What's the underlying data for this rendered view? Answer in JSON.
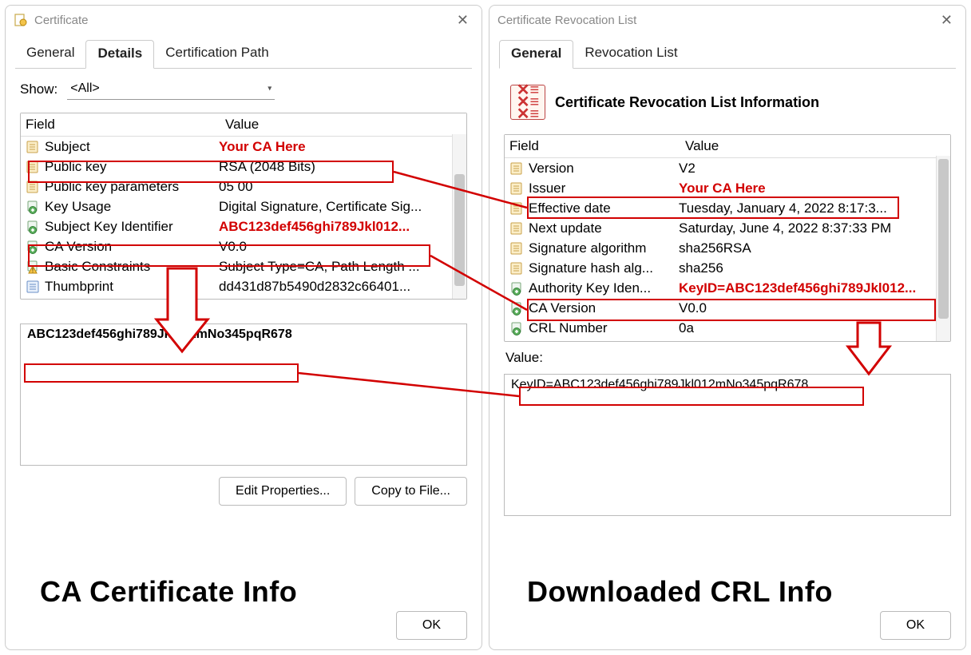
{
  "left": {
    "title": "Certificate",
    "tabs": [
      "General",
      "Details",
      "Certification Path"
    ],
    "activeTab": "Details",
    "showLabel": "Show:",
    "showValue": "<All>",
    "headers": {
      "field": "Field",
      "value": "Value"
    },
    "rows": [
      {
        "icon": "doc",
        "field": "Subject",
        "value": "Your CA Here",
        "highlight": true
      },
      {
        "icon": "doc",
        "field": "Public key",
        "value": "RSA (2048 Bits)"
      },
      {
        "icon": "doc",
        "field": "Public key parameters",
        "value": "05 00"
      },
      {
        "icon": "ext",
        "field": "Key Usage",
        "value": "Digital Signature, Certificate Sig..."
      },
      {
        "icon": "ext",
        "field": "Subject Key Identifier",
        "value": "ABC123def456ghi789Jkl012...",
        "highlight": true
      },
      {
        "icon": "ext",
        "field": "CA Version",
        "value": "V0.0"
      },
      {
        "icon": "warn",
        "field": "Basic Constraints",
        "value": "Subject Type=CA, Path Length ..."
      },
      {
        "icon": "prop",
        "field": "Thumbprint",
        "value": "dd431d87b5490d2832c66401..."
      }
    ],
    "detailValue": "ABC123def456ghi789Jkl012mNo345pqR678",
    "buttons": {
      "edit": "Edit Properties...",
      "copy": "Copy to File...",
      "ok": "OK"
    },
    "caption": "CA Certificate Info"
  },
  "right": {
    "title": "Certificate Revocation List",
    "tabs": [
      "General",
      "Revocation List"
    ],
    "activeTab": "General",
    "headerTitle": "Certificate Revocation List Information",
    "headers": {
      "field": "Field",
      "value": "Value"
    },
    "rows": [
      {
        "icon": "doc",
        "field": "Version",
        "value": "V2"
      },
      {
        "icon": "doc",
        "field": "Issuer",
        "value": "Your CA Here",
        "highlight": true
      },
      {
        "icon": "doc",
        "field": "Effective date",
        "value": "Tuesday, January 4, 2022 8:17:3..."
      },
      {
        "icon": "doc",
        "field": "Next update",
        "value": "Saturday, June 4, 2022 8:37:33 PM"
      },
      {
        "icon": "doc",
        "field": "Signature algorithm",
        "value": "sha256RSA"
      },
      {
        "icon": "doc",
        "field": "Signature hash alg...",
        "value": "sha256"
      },
      {
        "icon": "ext",
        "field": "Authority Key Iden...",
        "value": "KeyID=ABC123def456ghi789Jkl012...",
        "highlight": true
      },
      {
        "icon": "ext",
        "field": "CA Version",
        "value": "V0.0"
      },
      {
        "icon": "ext",
        "field": "CRL Number",
        "value": "0a"
      }
    ],
    "valueLabel": "Value:",
    "detailValue": "KeyID=ABC123def456ghi789Jkl012mNo345pqR678",
    "buttons": {
      "ok": "OK"
    },
    "caption": "Downloaded CRL Info"
  }
}
